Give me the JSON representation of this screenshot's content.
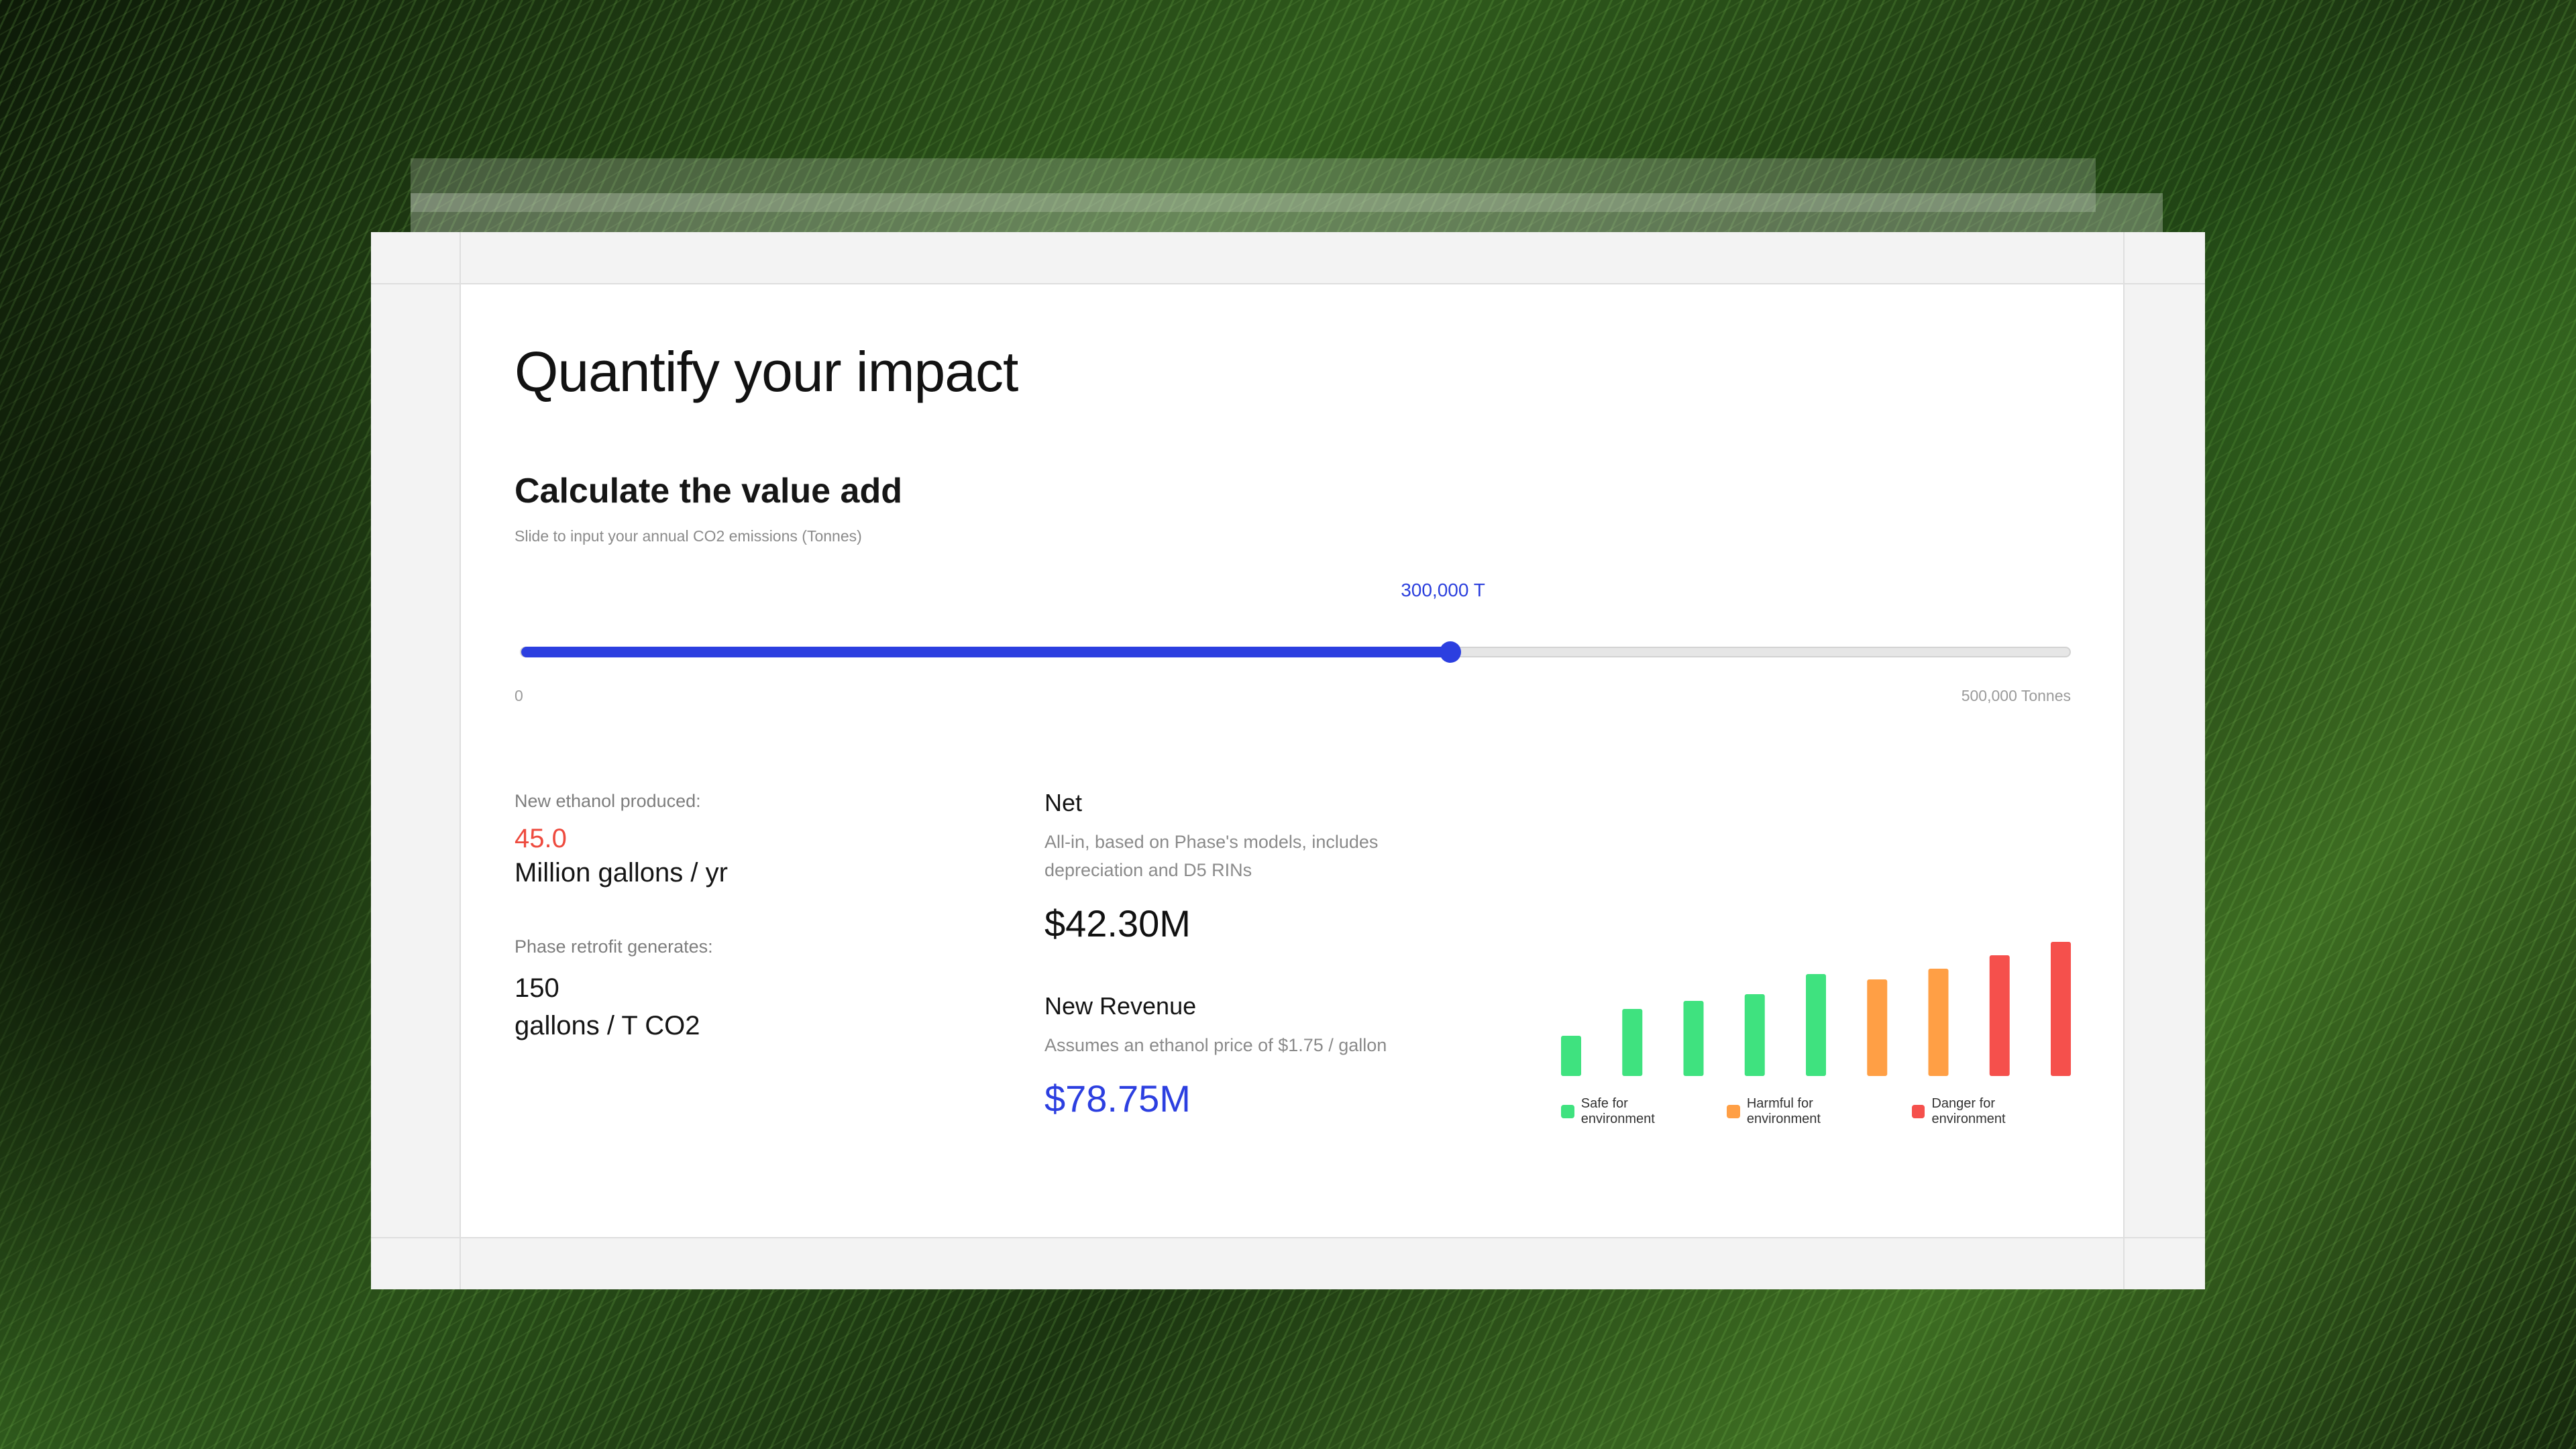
{
  "page": {
    "title": "Quantify your impact"
  },
  "calculator": {
    "title": "Calculate the value add",
    "subtitle": "Slide to input your annual CO2 emissions (Tonnes)",
    "slider": {
      "value": 300000,
      "value_label": "300,000 T",
      "min": 0,
      "max": 500000,
      "min_label": "0",
      "max_label": "500,000 Tonnes",
      "accent_color": "#2c3fe0"
    }
  },
  "stats": {
    "ethanol_label": "New ethanol produced:",
    "ethanol_value": "45.0",
    "ethanol_unit": "Million gallons / yr",
    "retrofit_label": "Phase retrofit generates:",
    "retrofit_value": "150",
    "retrofit_unit": "gallons / T CO2"
  },
  "net": {
    "title": "Net",
    "description": "All-in, based on Phase's models, includes depreciation and D5 RINs",
    "value": "$42.30M"
  },
  "revenue": {
    "title": "New Revenue",
    "description": "Assumes an ethanol price of $1.75 / gallon",
    "value": "$78.75M"
  },
  "chart_data": {
    "type": "bar",
    "values": [
      3,
      5,
      5.6,
      6.1,
      7.6,
      7.2,
      8,
      9,
      10
    ],
    "categories_status": [
      "safe",
      "safe",
      "safe",
      "safe",
      "safe",
      "harmful",
      "harmful",
      "danger",
      "danger"
    ],
    "ylim": [
      0,
      10
    ],
    "grid": false,
    "legend_placement": "bottom",
    "colors": {
      "safe": "#3fe27f",
      "harmful": "#ff9f45",
      "danger": "#f5504c"
    },
    "legend": [
      {
        "key": "safe",
        "label": "Safe for environment"
      },
      {
        "key": "harmful",
        "label": "Harmful for environment"
      },
      {
        "key": "danger",
        "label": "Danger for environment"
      }
    ]
  }
}
